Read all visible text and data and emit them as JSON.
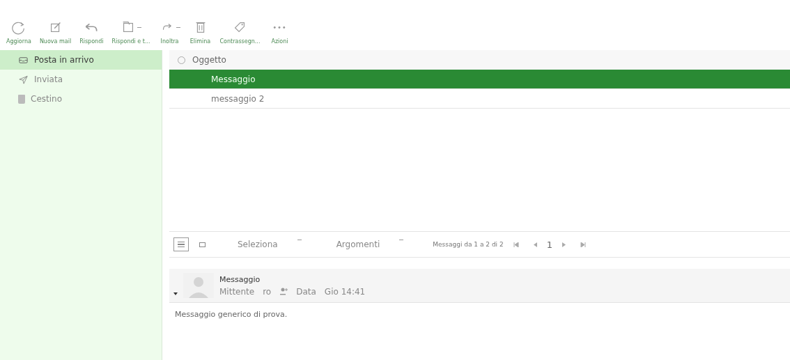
{
  "toolbar": [
    {
      "kind": "refresh",
      "label": "Aggiorna",
      "caret": false
    },
    {
      "kind": "compose",
      "label": "Nuova mail",
      "caret": false
    },
    {
      "kind": "reply",
      "label": "Rispondi",
      "caret": false
    },
    {
      "kind": "replyall",
      "label": "Rispondi e t...",
      "caret": true
    },
    {
      "kind": "forward",
      "label": "Inoltra",
      "caret": true
    },
    {
      "kind": "trash",
      "label": "Elimina",
      "caret": false
    },
    {
      "kind": "tag",
      "label": "Contrassegn...",
      "caret": false
    },
    {
      "kind": "dots",
      "label": "Azioni",
      "caret": false
    }
  ],
  "sidebar": {
    "items": [
      {
        "kind": "inbox",
        "label": "Posta in arrivo",
        "selected": true
      },
      {
        "kind": "sent",
        "label": "Inviata",
        "selected": false
      },
      {
        "kind": "trash",
        "label": "Cestino",
        "selected": false
      }
    ]
  },
  "message_list": {
    "column": "Oggetto",
    "rows": [
      {
        "subject": "Messaggio",
        "selected": true
      },
      {
        "subject": "messaggio 2",
        "selected": false
      }
    ]
  },
  "list_toolbar": {
    "views": [
      {
        "kind": "list",
        "selected": true
      },
      {
        "kind": "preview",
        "selected": false
      }
    ],
    "select": "Seleziona",
    "threads": "Argomenti",
    "range": "Messaggi da 1 a 2 di 2",
    "page": "1"
  },
  "preview": {
    "subject": "Messaggio",
    "from_label": "Mittente",
    "from": "ro",
    "date_label": "Data",
    "date": "Gio 14:41",
    "body": "Messaggio generico di prova."
  }
}
